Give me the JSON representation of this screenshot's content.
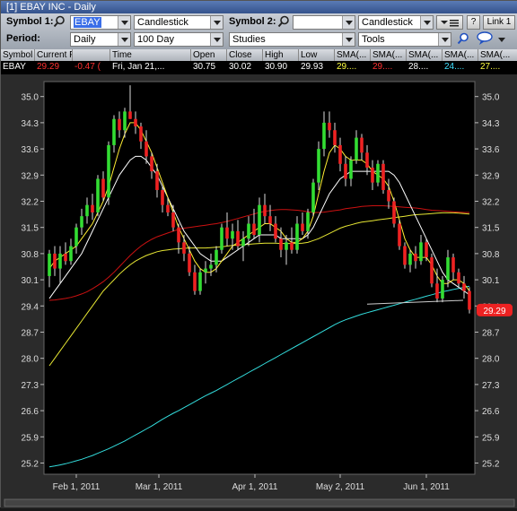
{
  "window": {
    "title": "[1] EBAY INC - Daily"
  },
  "toolbar": {
    "symbol1_label": "Symbol 1:",
    "symbol1_value": "EBAY",
    "charttype1": "Candlestick",
    "symbol2_label": "Symbol 2:",
    "symbol2_value": "",
    "charttype2": "Candlestick",
    "help": "?",
    "link": "Link 1",
    "period_label": "Period:",
    "period_value": "Daily",
    "range_value": "100 Day",
    "studies": "Studies",
    "tools": "Tools"
  },
  "quote": {
    "headers": [
      "Symbol",
      "Current Price",
      "",
      "Time",
      "Open",
      "Close",
      "High",
      "Low",
      "SMA(...",
      "SMA(...",
      "SMA(...",
      "SMA(...",
      "SMA(..."
    ],
    "values": [
      "EBAY",
      "29.29",
      "-0.47 (",
      "Fri, Jan 21,...",
      "30.75",
      "30.02",
      "30.90",
      "29.93",
      "29....",
      "29....",
      "28....",
      "24....",
      "27...."
    ],
    "colors": {
      "price": "#ff3030",
      "change": "#ff3030",
      "sma1": "#ffff40",
      "sma2": "#ff3030",
      "sma3": "#ffffff",
      "sma4": "#40e0ff",
      "sma5": "#ffff40"
    }
  },
  "chart_data": {
    "type": "candlestick",
    "y_ticks": [
      "35.0",
      "34.3",
      "33.6",
      "32.9",
      "32.2",
      "31.5",
      "30.8",
      "30.1",
      "29.4",
      "28.7",
      "28.0",
      "27.3",
      "26.6",
      "25.9",
      "25.2"
    ],
    "ylim": [
      24.9,
      35.4
    ],
    "x_ticks": [
      "Feb 1, 2011",
      "Mar 1, 2011",
      "Apr 1, 2011",
      "May 2, 2011",
      "Jun 1, 2011"
    ],
    "last_price_label": "29.29",
    "colors": {
      "up": "#33dd33",
      "down": "#ee2222",
      "sma_white": "#ffffff",
      "sma_yellow1": "#ffee33",
      "sma_red": "#cc1111",
      "sma_yellow2": "#e6e633",
      "sma_cyan": "#33dddd",
      "background": "#000000"
    },
    "candles": [
      [
        30.2,
        30.9,
        29.9,
        30.8
      ],
      [
        30.8,
        31.0,
        30.2,
        30.4
      ],
      [
        30.4,
        31.0,
        30.0,
        30.8
      ],
      [
        30.8,
        31.1,
        30.5,
        30.6
      ],
      [
        30.6,
        31.2,
        30.5,
        31.0
      ],
      [
        31.0,
        31.6,
        30.8,
        31.5
      ],
      [
        31.5,
        32.0,
        31.3,
        31.8
      ],
      [
        31.8,
        32.3,
        31.6,
        32.1
      ],
      [
        32.1,
        32.4,
        31.7,
        31.9
      ],
      [
        31.9,
        32.9,
        31.8,
        32.8
      ],
      [
        32.8,
        33.0,
        32.2,
        32.3
      ],
      [
        32.3,
        33.8,
        32.1,
        33.7
      ],
      [
        33.7,
        34.5,
        33.5,
        34.4
      ],
      [
        34.4,
        34.6,
        33.9,
        34.1
      ],
      [
        34.1,
        34.7,
        33.9,
        34.6
      ],
      [
        34.6,
        35.3,
        34.4,
        34.4
      ],
      [
        34.4,
        34.6,
        34.0,
        34.2
      ],
      [
        34.2,
        34.3,
        33.6,
        33.8
      ],
      [
        33.8,
        34.1,
        33.2,
        33.4
      ],
      [
        33.4,
        33.5,
        32.8,
        33.0
      ],
      [
        33.0,
        33.2,
        32.3,
        32.5
      ],
      [
        32.5,
        32.6,
        31.9,
        32.1
      ],
      [
        32.1,
        32.3,
        31.8,
        31.9
      ],
      [
        31.9,
        32.1,
        31.4,
        31.5
      ],
      [
        31.5,
        31.6,
        30.8,
        31.1
      ],
      [
        31.1,
        31.3,
        30.6,
        30.8
      ],
      [
        30.8,
        31.0,
        30.2,
        30.3
      ],
      [
        30.3,
        30.5,
        29.7,
        29.8
      ],
      [
        29.8,
        30.4,
        29.7,
        30.3
      ],
      [
        30.3,
        30.6,
        30.0,
        30.4
      ],
      [
        30.4,
        30.8,
        30.2,
        30.5
      ],
      [
        30.5,
        31.0,
        30.3,
        30.9
      ],
      [
        30.9,
        31.6,
        30.8,
        31.5
      ],
      [
        31.5,
        31.9,
        31.0,
        31.2
      ],
      [
        31.2,
        31.6,
        30.9,
        31.4
      ],
      [
        31.4,
        31.7,
        30.9,
        31.0
      ],
      [
        31.0,
        31.4,
        30.6,
        31.2
      ],
      [
        31.2,
        31.8,
        31.0,
        31.6
      ],
      [
        31.6,
        32.0,
        31.2,
        31.3
      ],
      [
        31.3,
        32.3,
        31.1,
        32.1
      ],
      [
        32.1,
        32.4,
        31.6,
        31.8
      ],
      [
        31.8,
        32.1,
        31.4,
        31.6
      ],
      [
        31.6,
        31.8,
        31.1,
        31.2
      ],
      [
        31.2,
        31.5,
        30.7,
        30.9
      ],
      [
        30.9,
        31.3,
        30.5,
        31.1
      ],
      [
        31.1,
        31.5,
        30.8,
        30.9
      ],
      [
        30.9,
        31.8,
        30.8,
        31.6
      ],
      [
        31.6,
        31.9,
        31.3,
        31.4
      ],
      [
        31.4,
        32.0,
        31.2,
        31.9
      ],
      [
        31.9,
        32.8,
        31.8,
        32.7
      ],
      [
        32.7,
        33.8,
        32.5,
        33.6
      ],
      [
        33.6,
        34.6,
        33.4,
        34.3
      ],
      [
        34.3,
        34.6,
        33.9,
        34.1
      ],
      [
        34.1,
        34.3,
        33.5,
        33.7
      ],
      [
        33.7,
        33.9,
        33.0,
        33.2
      ],
      [
        33.2,
        33.4,
        32.6,
        32.8
      ],
      [
        32.8,
        33.4,
        32.6,
        33.3
      ],
      [
        33.3,
        34.1,
        33.2,
        33.9
      ],
      [
        33.9,
        34.0,
        33.3,
        33.5
      ],
      [
        33.5,
        33.7,
        32.9,
        33.1
      ],
      [
        33.1,
        33.3,
        32.5,
        32.7
      ],
      [
        32.7,
        33.3,
        32.6,
        33.2
      ],
      [
        33.2,
        33.3,
        32.4,
        32.5
      ],
      [
        32.5,
        32.8,
        32.0,
        32.2
      ],
      [
        32.2,
        32.3,
        31.5,
        31.6
      ],
      [
        31.6,
        31.7,
        30.9,
        31.0
      ],
      [
        31.0,
        31.1,
        30.4,
        30.5
      ],
      [
        30.5,
        30.9,
        30.3,
        30.8
      ],
      [
        30.8,
        31.0,
        30.4,
        30.6
      ],
      [
        30.6,
        31.3,
        30.5,
        31.1
      ],
      [
        31.1,
        31.2,
        30.6,
        30.7
      ],
      [
        30.7,
        30.8,
        29.9,
        30.0
      ],
      [
        30.0,
        30.4,
        29.5,
        29.6
      ],
      [
        29.6,
        30.2,
        29.5,
        30.1
      ],
      [
        30.1,
        30.9,
        29.9,
        30.7
      ],
      [
        30.7,
        30.8,
        30.1,
        30.3
      ],
      [
        30.3,
        30.4,
        29.9,
        30.0
      ],
      [
        30.0,
        30.2,
        29.6,
        29.8
      ],
      [
        29.8,
        29.9,
        29.2,
        29.3
      ]
    ],
    "sma_white": [
      29.6,
      29.8,
      30.0,
      30.2,
      30.4,
      30.6,
      30.8,
      31.1,
      31.4,
      31.7,
      32.0,
      32.3,
      32.6,
      32.9,
      33.1,
      33.3,
      33.4,
      33.4,
      33.3,
      33.1,
      32.9,
      32.6,
      32.3,
      32.0,
      31.7,
      31.4,
      31.2,
      31.0,
      30.8,
      30.7,
      30.6,
      30.6,
      30.6,
      30.7,
      30.8,
      30.9,
      31.0,
      31.1,
      31.2,
      31.3,
      31.3,
      31.3,
      31.3,
      31.2,
      31.2,
      31.2,
      31.2,
      31.2,
      31.3,
      31.5,
      31.8,
      32.1,
      32.4,
      32.6,
      32.8,
      32.9,
      33.0,
      33.0,
      33.0,
      33.0,
      33.0,
      33.0,
      33.0,
      33.0,
      32.9,
      32.7,
      32.4,
      32.1,
      31.8,
      31.5,
      31.2,
      30.9,
      30.6,
      30.3,
      30.1,
      30.0,
      29.9,
      29.8,
      29.7
    ],
    "sma_yellow1": [
      30.4,
      30.6,
      30.7,
      30.8,
      30.9,
      31.0,
      31.2,
      31.4,
      31.6,
      31.9,
      32.2,
      32.6,
      33.1,
      33.6,
      34.0,
      34.3,
      34.3,
      34.1,
      33.8,
      33.5,
      33.1,
      32.7,
      32.3,
      31.9,
      31.5,
      31.2,
      30.9,
      30.6,
      30.4,
      30.3,
      30.3,
      30.4,
      30.6,
      30.8,
      31.0,
      31.1,
      31.2,
      31.3,
      31.4,
      31.5,
      31.6,
      31.6,
      31.5,
      31.4,
      31.2,
      31.1,
      31.1,
      31.2,
      31.4,
      31.8,
      32.4,
      33.0,
      33.5,
      33.7,
      33.6,
      33.4,
      33.3,
      33.3,
      33.3,
      33.2,
      33.0,
      32.9,
      32.8,
      32.6,
      32.2,
      31.7,
      31.2,
      30.9,
      30.7,
      30.7,
      30.7,
      30.5,
      30.2,
      30.0,
      30.0,
      30.1,
      30.1,
      30.0,
      29.8
    ],
    "sma_red": [
      29.55,
      29.56,
      29.58,
      29.6,
      29.63,
      29.67,
      29.72,
      29.78,
      29.86,
      29.95,
      30.05,
      30.17,
      30.3,
      30.45,
      30.6,
      30.75,
      30.88,
      31.0,
      31.1,
      31.18,
      31.25,
      31.3,
      31.35,
      31.4,
      31.45,
      31.48,
      31.5,
      31.52,
      31.54,
      31.56,
      31.58,
      31.6,
      31.63,
      31.66,
      31.7,
      31.74,
      31.78,
      31.82,
      31.86,
      31.9,
      31.93,
      31.95,
      31.97,
      31.98,
      31.98,
      31.97,
      31.96,
      31.94,
      31.92,
      31.9,
      31.9,
      31.91,
      31.93,
      31.95,
      31.97,
      32.0,
      32.02,
      32.04,
      32.06,
      32.07,
      32.08,
      32.08,
      32.08,
      32.07,
      32.06,
      32.05,
      32.04,
      32.03,
      32.02,
      32.0,
      31.98,
      31.96,
      31.95,
      31.94,
      31.93,
      31.92,
      31.91,
      31.9,
      31.9
    ],
    "sma_yellow2": [
      27.8,
      28.0,
      28.2,
      28.4,
      28.6,
      28.8,
      29.0,
      29.2,
      29.4,
      29.6,
      29.8,
      29.95,
      30.1,
      30.25,
      30.38,
      30.5,
      30.6,
      30.68,
      30.75,
      30.8,
      30.85,
      30.88,
      30.9,
      30.92,
      30.93,
      30.94,
      30.95,
      30.95,
      30.95,
      30.95,
      30.96,
      30.97,
      30.98,
      31.0,
      31.02,
      31.03,
      31.04,
      31.05,
      31.06,
      31.07,
      31.08,
      31.08,
      31.08,
      31.07,
      31.07,
      31.07,
      31.07,
      31.08,
      31.1,
      31.15,
      31.2,
      31.27,
      31.34,
      31.41,
      31.48,
      31.53,
      31.57,
      31.61,
      31.64,
      31.66,
      31.68,
      31.7,
      31.72,
      31.74,
      31.76,
      31.78,
      31.8,
      31.82,
      31.84,
      31.85,
      31.86,
      31.87,
      31.88,
      31.89,
      31.89,
      31.89,
      31.88,
      31.87,
      31.86
    ],
    "sma_cyan": [
      25.1,
      25.12,
      25.15,
      25.18,
      25.22,
      25.26,
      25.3,
      25.35,
      25.4,
      25.46,
      25.52,
      25.58,
      25.65,
      25.72,
      25.79,
      25.87,
      25.95,
      26.03,
      26.11,
      26.19,
      26.28,
      26.37,
      26.45,
      26.53,
      26.6,
      26.68,
      26.76,
      26.84,
      26.92,
      27.0,
      27.07,
      27.14,
      27.22,
      27.3,
      27.38,
      27.46,
      27.54,
      27.62,
      27.7,
      27.78,
      27.86,
      27.94,
      28.02,
      28.1,
      28.18,
      28.26,
      28.34,
      28.42,
      28.5,
      28.58,
      28.66,
      28.74,
      28.82,
      28.9,
      28.97,
      29.03,
      29.08,
      29.13,
      29.18,
      29.22,
      29.26,
      29.3,
      29.34,
      29.38,
      29.42,
      29.46,
      29.5,
      29.54,
      29.58,
      29.62,
      29.66,
      29.7,
      29.74,
      29.78,
      29.81,
      29.84,
      29.87,
      29.9,
      29.93
    ],
    "trendline": [
      29.45,
      29.55
    ]
  }
}
